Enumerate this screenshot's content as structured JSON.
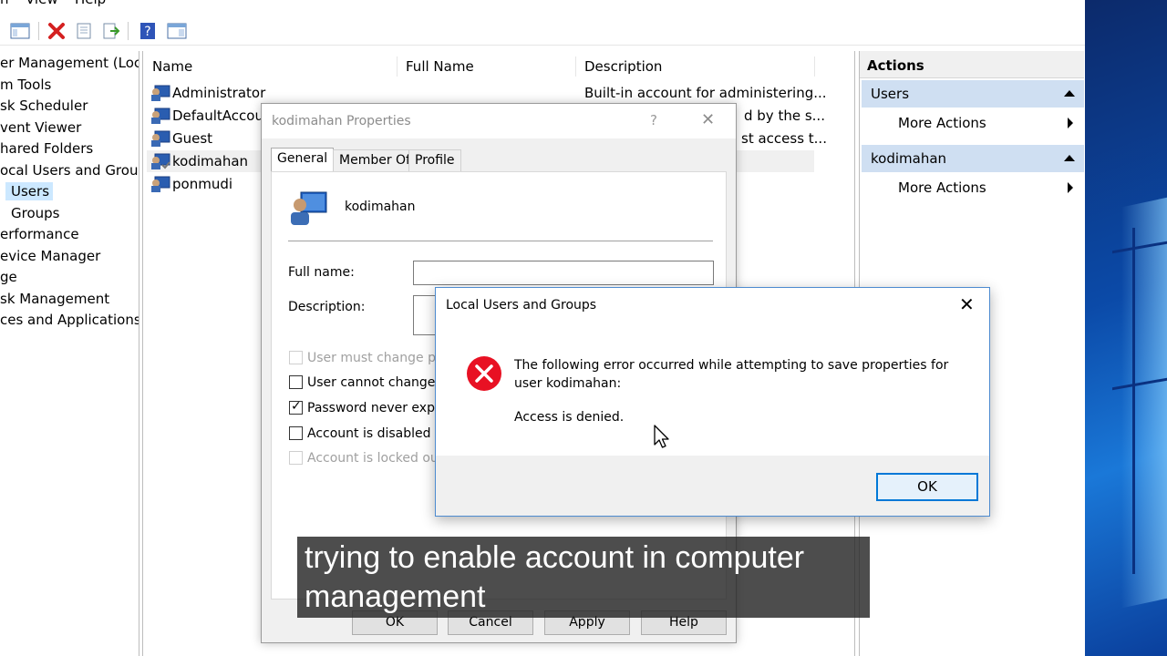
{
  "menubar": {
    "items": [
      "n",
      "View",
      "Help"
    ]
  },
  "toolbar": {
    "buttons": [
      "console-tree-icon",
      "delete-icon",
      "properties-icon",
      "export-icon",
      "help-icon",
      "show-hide-icon"
    ]
  },
  "tree": {
    "items": [
      "er Management (Local",
      "m Tools",
      "sk Scheduler",
      "vent Viewer",
      "hared Folders",
      "ocal Users and Groups",
      "Users",
      "Groups",
      "erformance",
      "evice Manager",
      "ge",
      "sk Management",
      "ces and Applications"
    ]
  },
  "list": {
    "columns": {
      "name": "Name",
      "full_name": "Full Name",
      "description": "Description"
    },
    "rows": [
      {
        "name": "Administrator",
        "description": "Built-in account for administering..."
      },
      {
        "name": "DefaultAccour",
        "description": "d by the s..."
      },
      {
        "name": "Guest",
        "description": "st access t..."
      },
      {
        "name": "kodimahan",
        "description": ""
      },
      {
        "name": "ponmudi",
        "description": ""
      }
    ]
  },
  "actions": {
    "title": "Actions",
    "sections": [
      {
        "label": "Users",
        "item": "More Actions"
      },
      {
        "label": "kodimahan",
        "item": "More Actions"
      }
    ]
  },
  "props": {
    "title": "kodimahan Properties",
    "help_glyph": "?",
    "close_glyph": "✕",
    "tabs": [
      "General",
      "Member Of",
      "Profile"
    ],
    "username": "kodimahan",
    "full_name_label": "Full name:",
    "full_name_value": "",
    "description_label": "Description:",
    "description_value": "",
    "checkboxes": [
      {
        "label": "User must change pass",
        "checked": false,
        "disabled": true
      },
      {
        "label": "User cannot change pa",
        "checked": false,
        "disabled": false
      },
      {
        "label": "Password never expires",
        "checked": true,
        "disabled": false
      },
      {
        "label": "Account is disabled",
        "checked": false,
        "disabled": false
      },
      {
        "label": "Account is locked out",
        "checked": false,
        "disabled": true
      }
    ],
    "buttons": {
      "ok": "OK",
      "cancel": "Cancel",
      "apply": "Apply",
      "help": "Help"
    }
  },
  "error": {
    "title": "Local Users and Groups",
    "close_glyph": "✕",
    "message": "The following error occurred while attempting to save properties for user kodimahan:",
    "detail": "Access is denied.",
    "ok": "OK"
  },
  "caption": {
    "text": "trying to enable account in computer management"
  },
  "colors": {
    "selection": "#cce8ff",
    "actions_section": "#cfdff2",
    "error_red": "#e81123",
    "accent": "#0078d7"
  }
}
